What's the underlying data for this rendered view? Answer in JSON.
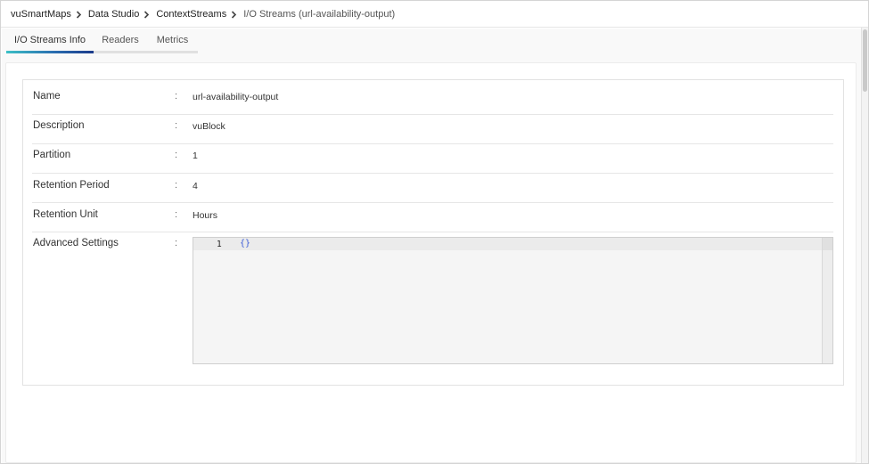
{
  "breadcrumb": {
    "items": [
      "vuSmartMaps",
      "Data Studio",
      "ContextStreams",
      "I/O Streams (url-availability-output)"
    ]
  },
  "tabs": [
    "I/O Streams Info",
    "Readers",
    "Metrics"
  ],
  "active_tab": "I/O Streams Info",
  "details": {
    "separator": ":",
    "rows": [
      {
        "label": "Name",
        "value": "url-availability-output"
      },
      {
        "label": "Description",
        "value": "vuBlock"
      },
      {
        "label": "Partition",
        "value": "1"
      },
      {
        "label": "Retention Period",
        "value": "4"
      },
      {
        "label": "Retention Unit",
        "value": "Hours"
      },
      {
        "label": "Advanced Settings"
      }
    ]
  },
  "editor": {
    "line_number": "1",
    "code": "{}"
  },
  "colors": {
    "tab_indicator_start": "#3cc0c6",
    "tab_indicator_end": "#1b3a8a",
    "code_brace": "#3f5fd8"
  }
}
